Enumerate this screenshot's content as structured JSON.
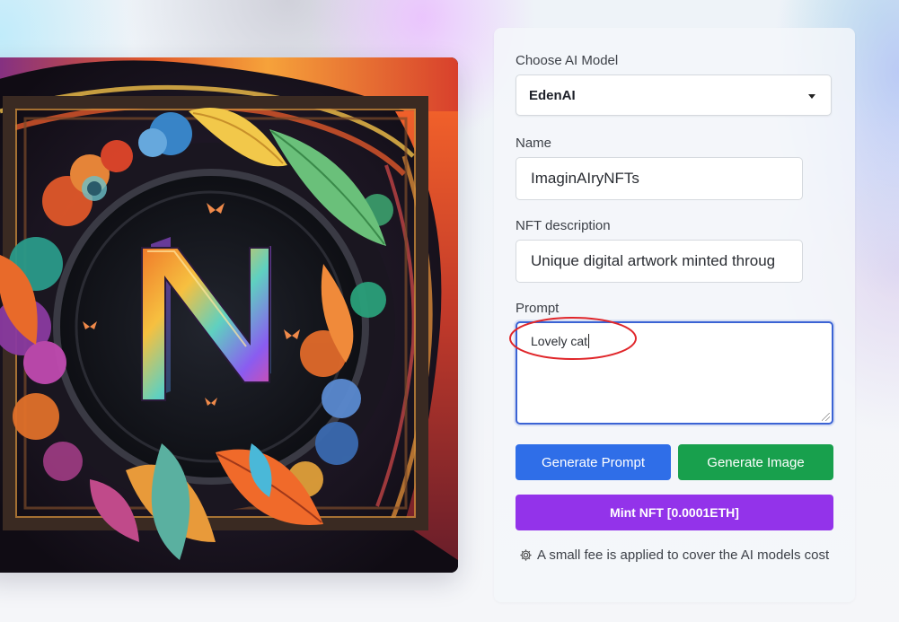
{
  "form": {
    "model_label": "Choose AI Model",
    "model_selected": "EdenAI",
    "name_label": "Name",
    "name_value": "ImaginAIryNFTs",
    "description_label": "NFT description",
    "description_value": "Unique digital artwork minted throug",
    "prompt_label": "Prompt",
    "prompt_value": "Lovely cat",
    "generate_prompt_label": "Generate Prompt",
    "generate_image_label": "Generate Image",
    "mint_label": "Mint NFT [0.0001ETH]",
    "fee_note": "A small fee is applied to cover the AI models cost"
  },
  "art": {
    "letter": "N"
  },
  "colors": {
    "blue_button": "#2f6ee8",
    "green_button": "#18a04d",
    "purple_button": "#9333ea",
    "focus_border": "#3b63d4",
    "annotation": "#e0262a"
  },
  "icons": {
    "caret": "caret-down-icon",
    "gear": "gear-icon"
  }
}
